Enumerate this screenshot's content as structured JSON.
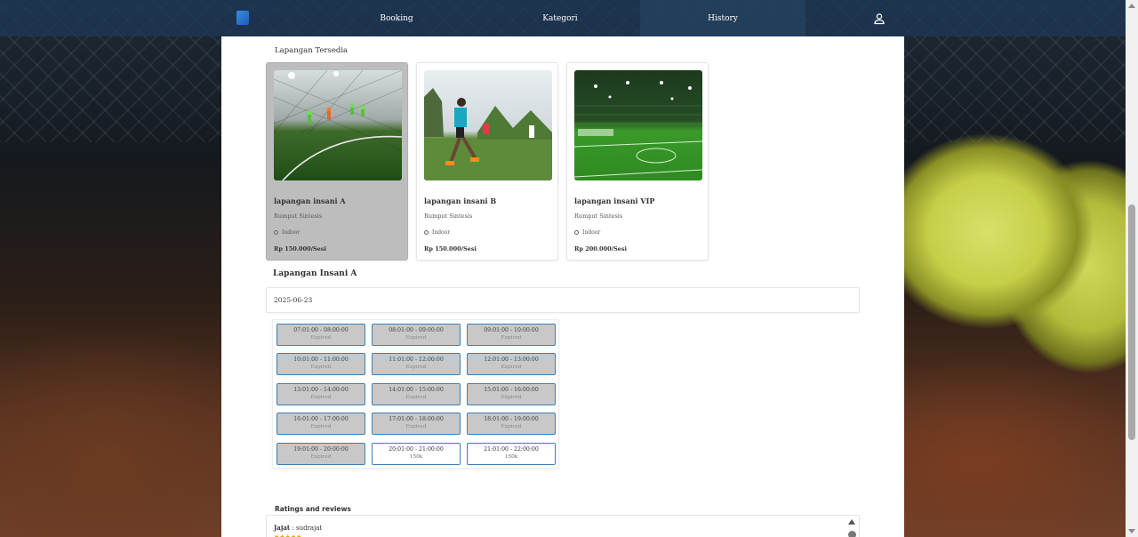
{
  "nav": {
    "items": [
      {
        "label": "Booking"
      },
      {
        "label": "Kategori"
      },
      {
        "label": "History"
      }
    ]
  },
  "fields_section": {
    "title": "Lapangan Tersedia",
    "cards": [
      {
        "name": "lapangan insani A",
        "surface": "Rumput Sintesis",
        "type": "Indoor",
        "price": "Rp 150.000/Sesi",
        "selected": true
      },
      {
        "name": "lapangan insani B",
        "surface": "Rumput Sintesis",
        "type": "Indoor",
        "price": "Rp 150.000/Sesi",
        "selected": false
      },
      {
        "name": "lapangan insani VIP",
        "surface": "Rumput Sintesis",
        "type": "Indoor",
        "price": "Rp 200.000/Sesi",
        "selected": false
      }
    ]
  },
  "booking": {
    "venue_title": "Lapangan Insani A",
    "date": "2025-06-23",
    "slots": [
      {
        "time": "07:01:00 - 08:00:00",
        "status": "Expired"
      },
      {
        "time": "08:01:00 - 09:00:00",
        "status": "Expired"
      },
      {
        "time": "09:01:00 - 10:00:00",
        "status": "Expired"
      },
      {
        "time": "10:01:00 - 11:00:00",
        "status": "Expired"
      },
      {
        "time": "11:01:00 - 12:00:00",
        "status": "Expired"
      },
      {
        "time": "12:01:00 - 13:00:00",
        "status": "Expired"
      },
      {
        "time": "13:01:00 - 14:00:00",
        "status": "Expired"
      },
      {
        "time": "14:01:00 - 15:00:00",
        "status": "Expired"
      },
      {
        "time": "15:01:00 - 16:00:00",
        "status": "Expired"
      },
      {
        "time": "16:01:00 - 17:00:00",
        "status": "Expired"
      },
      {
        "time": "17:01:00 - 18:00:00",
        "status": "Expired"
      },
      {
        "time": "18:01:00 - 19:00:00",
        "status": "Expired"
      },
      {
        "time": "19:01:00 - 20:00:00",
        "status": "Expired"
      },
      {
        "time": "20:01:00 - 21:00:00",
        "status": "150k"
      },
      {
        "time": "21:01:00 - 22:00:00",
        "status": "150k"
      }
    ]
  },
  "reviews": {
    "title": "Ratings and reviews",
    "items": [
      {
        "name": "Jajat",
        "username": "sudrajat",
        "stars": "★★★★★"
      }
    ]
  },
  "colors": {
    "nav_bg": "#1e3755",
    "slot_border": "#3d7fb0",
    "selected_card": "#bdbdbd"
  }
}
